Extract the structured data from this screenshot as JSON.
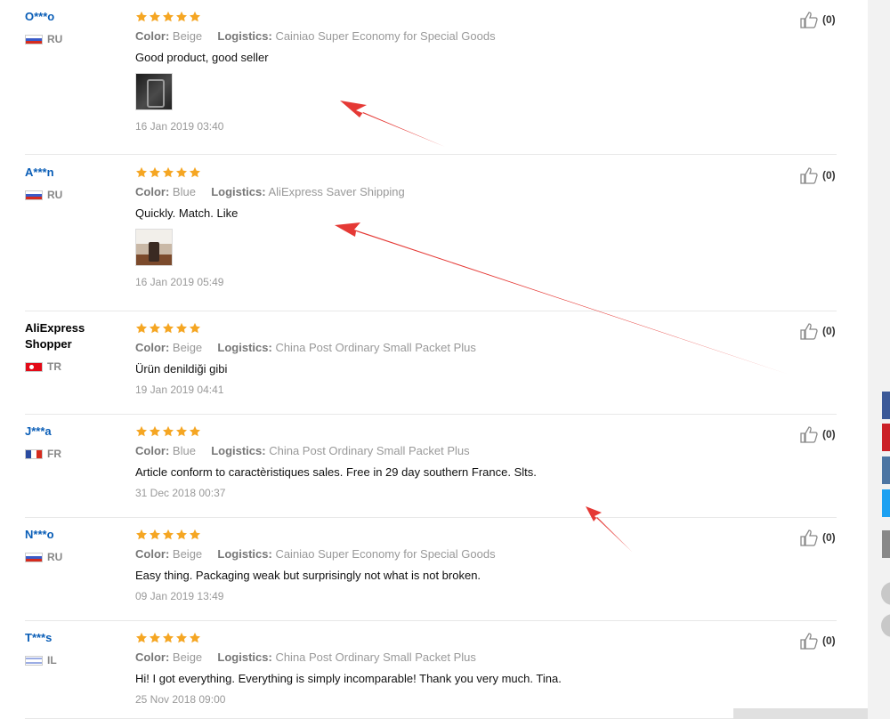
{
  "reviews": [
    {
      "user": "O***o",
      "user_is_link": true,
      "flag": "ru",
      "country": "RU",
      "color_label": "Color:",
      "color": "Beige",
      "logistics_label": "Logistics:",
      "logistics": "Cainiao Super Economy for Special Goods",
      "text": "Good product, good seller",
      "has_photo": true,
      "photo_style": "dark",
      "date": "16 Jan 2019 03:40",
      "rating": 5,
      "helpful": "(0)"
    },
    {
      "user": "A***n",
      "user_is_link": true,
      "flag": "ru",
      "country": "RU",
      "color_label": "Color:",
      "color": "Blue",
      "logistics_label": "Logistics:",
      "logistics": "AliExpress Saver Shipping",
      "text": "Quickly. Match. Like",
      "has_photo": true,
      "photo_style": "light",
      "date": "16 Jan 2019 05:49",
      "rating": 5,
      "helpful": "(0)"
    },
    {
      "user": "AliExpress Shopper",
      "user_is_link": false,
      "flag": "tr",
      "country": "TR",
      "color_label": "Color:",
      "color": "Beige",
      "logistics_label": "Logistics:",
      "logistics": "China Post Ordinary Small Packet Plus",
      "text": "Ürün denildiği gibi",
      "has_photo": false,
      "date": "19 Jan 2019 04:41",
      "rating": 5,
      "helpful": "(0)"
    },
    {
      "user": "J***a",
      "user_is_link": true,
      "flag": "fr",
      "country": "FR",
      "color_label": "Color:",
      "color": "Blue",
      "logistics_label": "Logistics:",
      "logistics": "China Post Ordinary Small Packet Plus",
      "text": "Article conform to caractèristiques sales. Free in 29 day southern France. Slts.",
      "has_photo": false,
      "date": "31 Dec 2018 00:37",
      "rating": 5,
      "helpful": "(0)"
    },
    {
      "user": "N***o",
      "user_is_link": true,
      "flag": "ru",
      "country": "RU",
      "color_label": "Color:",
      "color": "Beige",
      "logistics_label": "Logistics:",
      "logistics": "Cainiao Super Economy for Special Goods",
      "text": "Easy thing. Packaging weak but surprisingly not what is not broken.",
      "has_photo": false,
      "date": "09 Jan 2019 13:49",
      "rating": 5,
      "helpful": "(0)"
    },
    {
      "user": "T***s",
      "user_is_link": true,
      "flag": "il",
      "country": "IL",
      "color_label": "Color:",
      "color": "Beige",
      "logistics_label": "Logistics:",
      "logistics": "China Post Ordinary Small Packet Plus",
      "text": "Hi! I got everything. Everything is simply incomparable! Thank you very much. Tina.",
      "has_photo": false,
      "date": "25 Nov 2018 09:00",
      "rating": 5,
      "helpful": "(0)"
    }
  ],
  "colors": {
    "link": "#0a5eb7",
    "star": "#f5a623",
    "arrow": "#e53935",
    "share_buttons": [
      "#3b5998",
      "#cb2027",
      "#4c75a3",
      "#1da1f2",
      "#888888"
    ]
  },
  "icons": {
    "rating": "star-icon",
    "helpful": "thumbs-up-icon"
  }
}
